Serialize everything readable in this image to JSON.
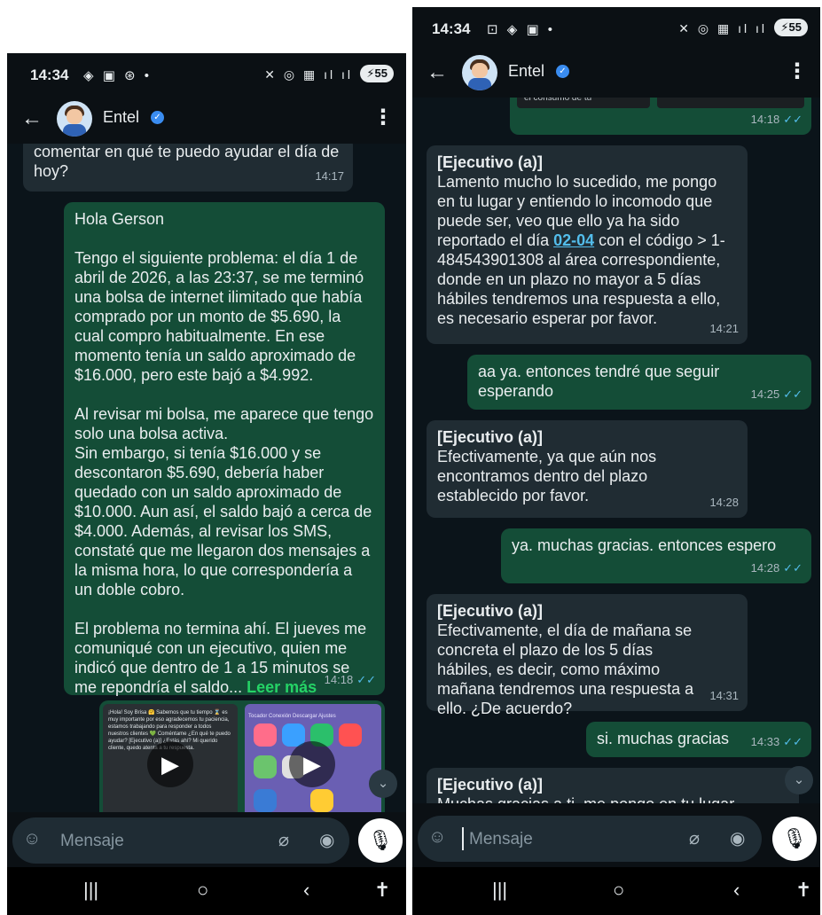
{
  "app": {
    "contact_name": "Entel",
    "verified_icon": "verified-badge-icon",
    "accent": "#53bdeb",
    "outgoing_bubble": "#144d37",
    "incoming_bubble": "#202c33"
  },
  "left": {
    "status": {
      "time": "14:34",
      "battery": "55"
    },
    "messages": [
      {
        "dir": "in",
        "text": "comentar en qué te puedo ayudar el día de hoy?",
        "time": "14:17"
      },
      {
        "dir": "out",
        "text": "Hola Gerson\n\nTengo el siguiente problema: el día 1 de abril de 2026, a las 23:37, se me terminó una bolsa de internet ilimitado que había comprado por un monto de $5.690, la cual compro habitualmente. En ese momento tenía un saldo aproximado de $16.000, pero este bajó a $4.992.\n\nAl revisar mi bolsa, me aparece que tengo solo una bolsa activa.\nSin embargo, si tenía $16.000 y se descontaron $5.690, debería haber quedado con un saldo aproximado de $10.000. Aun así, el saldo bajó a cerca de $4.000. Además, al revisar los SMS, constaté que me llegaron dos mensajes a la misma hora, lo que correspondería a un doble cobro.\n\nEl problema no termina ahí. El jueves me comuniqué con un ejecutivo, quien me indicó que dentro de 1 a 15 minutos se me repondría el saldo...",
        "read_more": "Leer más",
        "time": "14:18"
      }
    ],
    "thumbnails": [
      {
        "label": "¡Hola! Soy Brisa 🤗 Sabemos que tu tiempo ⌛ es muy importante por eso agradecemos tu paciencia, estamos trabajando para responder a todos nuestros clientes 💚 Coméntame ¿En qué te puedo ayudar?  [Ejecutivo (a)] ¿Estás ahí? Mi querido cliente, quedo atenta a tu respuesta."
      },
      {
        "label": "Tocador  Conexión  Descargar  Ajustes"
      }
    ],
    "input_placeholder": "Mensaje"
  },
  "right": {
    "status": {
      "time": "14:34",
      "battery": "55"
    },
    "top_snippet": {
      "text": "el consumo de tu",
      "time": "14:18"
    },
    "messages": [
      {
        "dir": "in",
        "sender": "[Ejecutivo (a)]",
        "text_a": "Lamento mucho lo sucedido, me pongo en tu lugar y entiendo lo incomodo que puede ser, veo que ello ya ha sido reportado el día ",
        "link": "02-04",
        "text_b": " con el código > 1-484543901308 al área correspondiente, donde en un plazo no mayor a 5 días hábiles tendremos una respuesta a ello, es necesario esperar por favor.",
        "time": "14:21"
      },
      {
        "dir": "out",
        "text": "aa ya. entonces tendré que seguir esperando",
        "time": "14:25"
      },
      {
        "dir": "in",
        "sender": "[Ejecutivo (a)]",
        "text": "Efectivamente, ya que aún nos encontramos dentro del plazo establecido por favor.",
        "time": "14:28"
      },
      {
        "dir": "out",
        "text": "ya. muchas gracias. entonces espero",
        "time": "14:28"
      },
      {
        "dir": "in",
        "sender": "[Ejecutivo (a)]",
        "text": "Efectivamente, el día de mañana se concreta el plazo de los 5 días hábiles, es decir, como máximo mañana tendremos una respuesta a ello. ¿De acuerdo?",
        "time": "14:31"
      },
      {
        "dir": "out",
        "text": "si. muchas gracias",
        "time": "14:33"
      },
      {
        "dir": "in",
        "sender": "[Ejecutivo (a)]",
        "text": "Muchas gracias a ti, me pongo en tu lugar"
      }
    ],
    "input_placeholder": "Mensaje"
  }
}
